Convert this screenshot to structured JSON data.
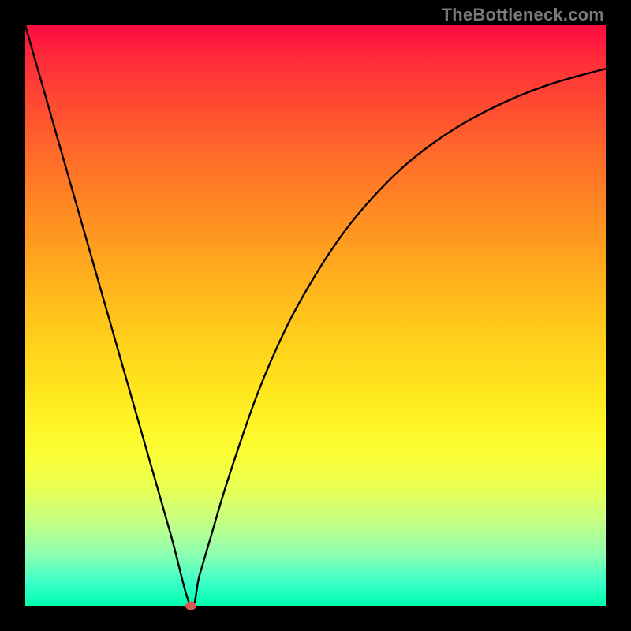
{
  "watermark": "TheBottleneck.com",
  "colors": {
    "frame_bg": "#000000",
    "curve_stroke": "#000000",
    "min_dot": "#d85a55"
  },
  "chart_data": {
    "type": "line",
    "title": "",
    "xlabel": "",
    "ylabel": "",
    "grid": false,
    "legend": false,
    "x_domain_note": "normalized 0–1 (no axis ticks shown)",
    "y_domain_note": "normalized 0–1 (no axis ticks shown)",
    "xlim": [
      0,
      1
    ],
    "ylim": [
      0,
      1
    ],
    "series": [
      {
        "name": "bottleneck-curve",
        "x": [
          0.0,
          0.05,
          0.1,
          0.15,
          0.2,
          0.25,
          0.285,
          0.3,
          0.32,
          0.35,
          0.4,
          0.45,
          0.5,
          0.55,
          0.6,
          0.65,
          0.7,
          0.75,
          0.8,
          0.85,
          0.9,
          0.95,
          1.0
        ],
        "y": [
          1.0,
          0.825,
          0.65,
          0.475,
          0.3,
          0.125,
          0.0,
          0.052,
          0.12,
          0.22,
          0.365,
          0.48,
          0.57,
          0.645,
          0.705,
          0.755,
          0.795,
          0.828,
          0.855,
          0.878,
          0.897,
          0.912,
          0.925
        ]
      }
    ],
    "minimum_marker": {
      "x": 0.285,
      "y": 0.0
    },
    "background_gradient": {
      "stops": [
        {
          "pos": 0.0,
          "color": "#ff0a40"
        },
        {
          "pos": 0.12,
          "color": "#ff4433"
        },
        {
          "pos": 0.32,
          "color": "#ff8a22"
        },
        {
          "pos": 0.52,
          "color": "#ffc91a"
        },
        {
          "pos": 0.7,
          "color": "#fff82a"
        },
        {
          "pos": 0.85,
          "color": "#c8ff80"
        },
        {
          "pos": 1.0,
          "color": "#00ffb0"
        }
      ]
    }
  }
}
